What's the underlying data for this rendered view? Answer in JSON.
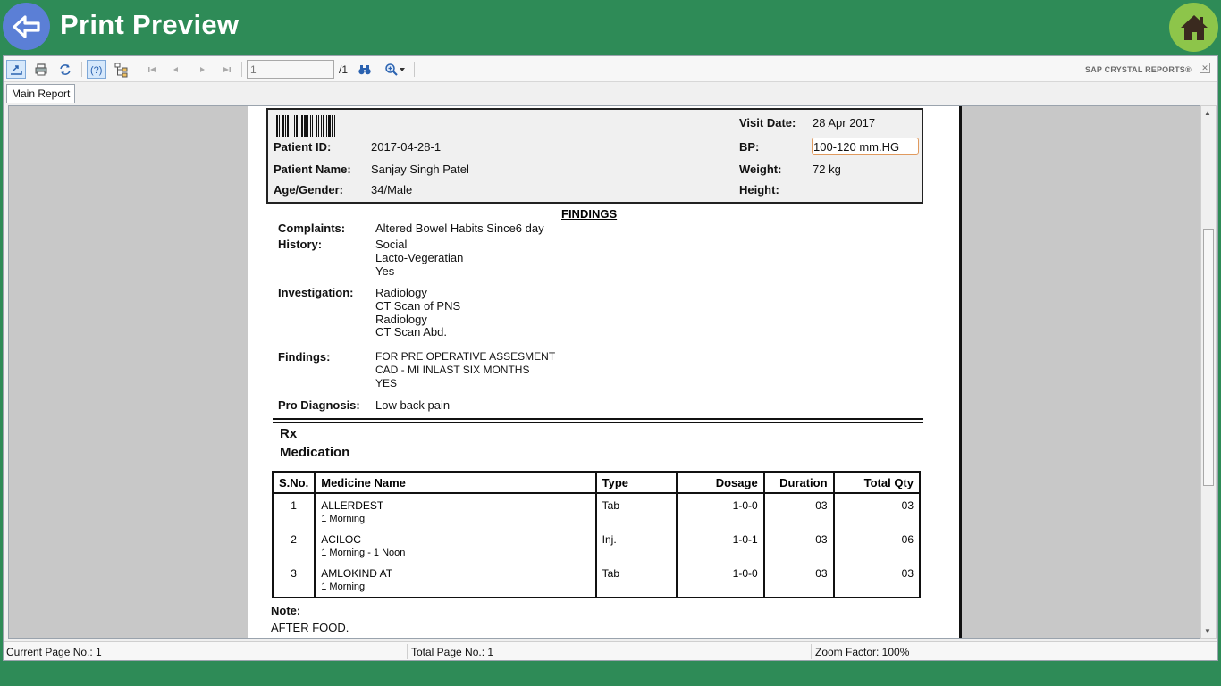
{
  "header": {
    "title": "Print Preview",
    "back_icon": "arrow-left-icon",
    "home_icon": "home-icon"
  },
  "toolbar": {
    "page_value": "1",
    "page_total": "/1",
    "brand": "SAP CRYSTAL REPORTS®",
    "close": "✕"
  },
  "tabs": [
    {
      "label": "Main Report"
    }
  ],
  "status": {
    "current_page": "Current Page No.: 1",
    "total_page": "Total Page No.: 1",
    "zoom": "Zoom Factor: 100%"
  },
  "report": {
    "patient": {
      "id_label": "Patient ID:",
      "id_value": "2017-04-28-1",
      "name_label": "Patient Name:",
      "name_value": "Sanjay Singh Patel",
      "age_label": "Age/Gender:",
      "age_value": "34/Male",
      "visit_label": "Visit Date:",
      "visit_value": "28 Apr 2017",
      "bp_label": "BP:",
      "bp_value": "100-120 mm.HG",
      "weight_label": "Weight:",
      "weight_value": "72 kg",
      "height_label": "Height:",
      "height_value": ""
    },
    "findings_title": "FINDINGS",
    "sections": {
      "complaints_label": "Complaints:",
      "complaints": [
        "Altered Bowel Habits Since6 day"
      ],
      "history_label": "History:",
      "history": [
        "Social",
        "Lacto-Vegeratian",
        "Yes"
      ],
      "investigation_label": "Investigation:",
      "investigation": [
        "Radiology",
        "CT Scan of PNS",
        "Radiology",
        "CT Scan Abd."
      ],
      "findings_label": "Findings:",
      "findings": [
        "FOR PRE OPERATIVE ASSESMENT",
        "CAD - MI INLAST SIX MONTHS",
        "YES"
      ],
      "diagnosis_label": "Pro Diagnosis:",
      "diagnosis": "Low back pain"
    },
    "rx": "Rx",
    "medication": "Medication",
    "table": {
      "headers": [
        "S.No.",
        "Medicine Name",
        "Type",
        "Dosage",
        "Duration",
        "Total Qty"
      ],
      "rows": [
        {
          "sno": "1",
          "name": "ALLERDEST",
          "timing": "1 Morning",
          "type": "Tab",
          "dosage": "1-0-0",
          "duration": "03",
          "qty": "03"
        },
        {
          "sno": "2",
          "name": "ACILOC",
          "timing": "1 Morning - 1 Noon",
          "type": "Inj.",
          "dosage": "1-0-1",
          "duration": "03",
          "qty": "06"
        },
        {
          "sno": "3",
          "name": "AMLOKIND AT",
          "timing": "1 Morning",
          "type": "Tab",
          "dosage": "1-0-0",
          "duration": "03",
          "qty": "03"
        }
      ]
    },
    "note_label": "Note:",
    "note": "AFTER FOOD."
  }
}
